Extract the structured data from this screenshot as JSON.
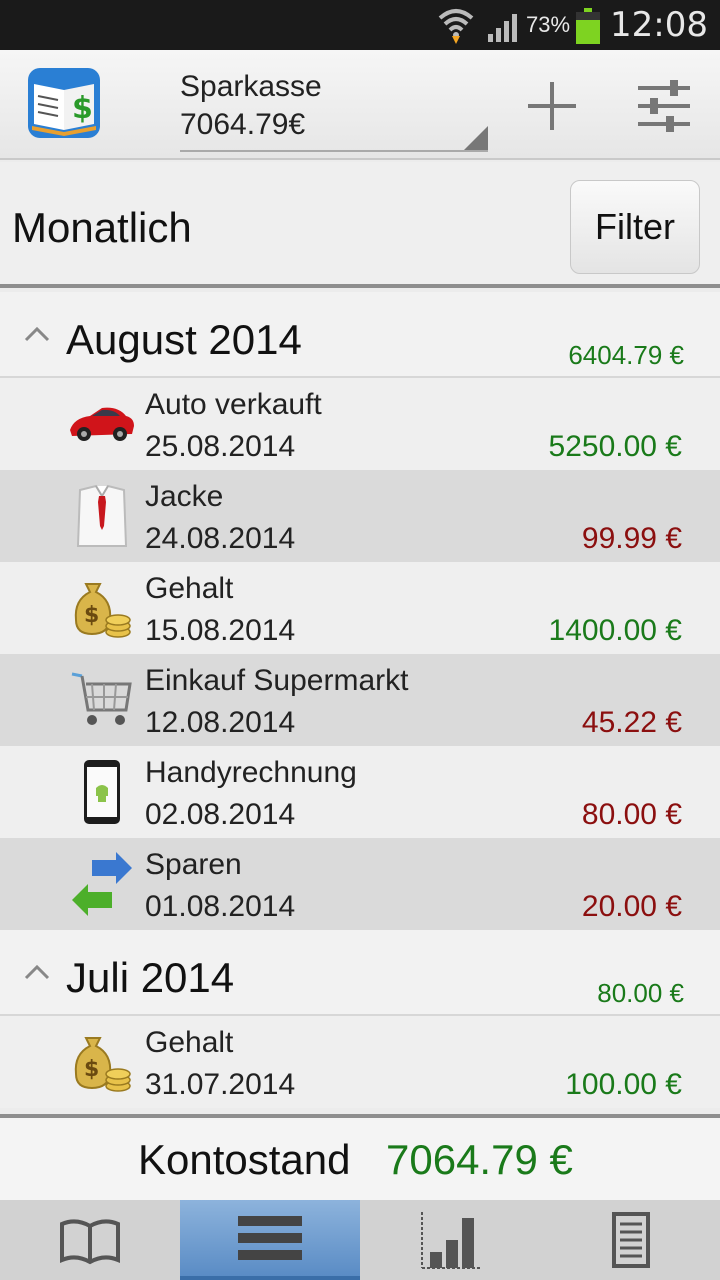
{
  "status_bar": {
    "battery_percent": "73%",
    "time": "12:08"
  },
  "action_bar": {
    "account_name": "Sparkasse",
    "account_balance": "7064.79€"
  },
  "filter_bar": {
    "period": "Monatlich",
    "filter_label": "Filter"
  },
  "groups": [
    {
      "title": "August 2014",
      "sum": "6404.79 €",
      "items": [
        {
          "name": "Auto verkauft",
          "date": "25.08.2014",
          "amount": "5250.00 €",
          "type": "income",
          "icon": "car-icon"
        },
        {
          "name": "Jacke",
          "date": "24.08.2014",
          "amount": "99.99 €",
          "type": "expense",
          "icon": "shirt-icon"
        },
        {
          "name": "Gehalt",
          "date": "15.08.2014",
          "amount": "1400.00 €",
          "type": "income",
          "icon": "money-bag-icon"
        },
        {
          "name": "Einkauf Supermarkt",
          "date": "12.08.2014",
          "amount": "45.22 €",
          "type": "expense",
          "icon": "shopping-cart-icon"
        },
        {
          "name": "Handyrechnung",
          "date": "02.08.2014",
          "amount": "80.00 €",
          "type": "expense",
          "icon": "smartphone-icon"
        },
        {
          "name": "Sparen",
          "date": "01.08.2014",
          "amount": "20.00 €",
          "type": "expense",
          "icon": "transfer-arrows-icon"
        }
      ]
    },
    {
      "title": "Juli 2014",
      "sum": "80.00 €",
      "items": [
        {
          "name": "Gehalt",
          "date": "31.07.2014",
          "amount": "100.00 €",
          "type": "income",
          "icon": "money-bag-icon"
        }
      ]
    }
  ],
  "footer": {
    "balance_label": "Kontostand",
    "balance_value": "7064.79 €"
  },
  "tabs": [
    {
      "icon": "book-icon",
      "active": false
    },
    {
      "icon": "list-icon",
      "active": true
    },
    {
      "icon": "bar-chart-icon",
      "active": false
    },
    {
      "icon": "document-icon",
      "active": false
    }
  ],
  "colors": {
    "income": "#1a7a1a",
    "expense": "#8b0f0f",
    "active_tab": "#5a8cc5"
  }
}
